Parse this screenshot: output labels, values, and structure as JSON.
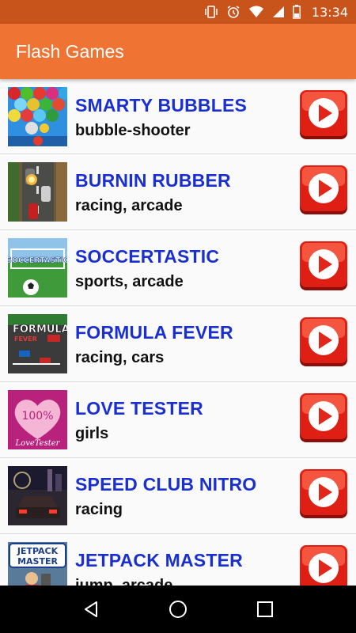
{
  "status_bar": {
    "time": "13:34",
    "icons": [
      "vibrate-icon",
      "alarm-icon",
      "wifi-icon",
      "signal-icon",
      "battery-icon"
    ],
    "background": "#c9541b"
  },
  "app_bar": {
    "title": "Flash Games",
    "background": "#ef7433"
  },
  "games": [
    {
      "title": "SMARTY BUBBLES",
      "tags": "bubble-shooter"
    },
    {
      "title": "BURNIN RUBBER",
      "tags": "racing, arcade"
    },
    {
      "title": "SOCCERTASTIC",
      "tags": "sports, arcade"
    },
    {
      "title": "FORMULA FEVER",
      "tags": "racing, cars"
    },
    {
      "title": "LOVE TESTER",
      "tags": "girls"
    },
    {
      "title": "SPEED CLUB NITRO",
      "tags": "racing"
    },
    {
      "title": "JETPACK MASTER",
      "tags": "jump, arcade"
    }
  ],
  "thumbnail_text": {
    "soccertastic": "SOCCERTASTIC",
    "formula_fever_1": "FORMULA",
    "formula_fever_2": "FEVER",
    "love_tester_pct": "100%",
    "love_tester_brand": "LoveTester",
    "jetpack_1": "JETPACK",
    "jetpack_2": "MASTER"
  },
  "colors": {
    "title_blue": "#1a2fcf",
    "play_red": "#e01f14",
    "accent_orange": "#ef7433"
  },
  "nav_bar": {
    "icons": [
      "back-icon",
      "home-icon",
      "recents-icon"
    ]
  }
}
